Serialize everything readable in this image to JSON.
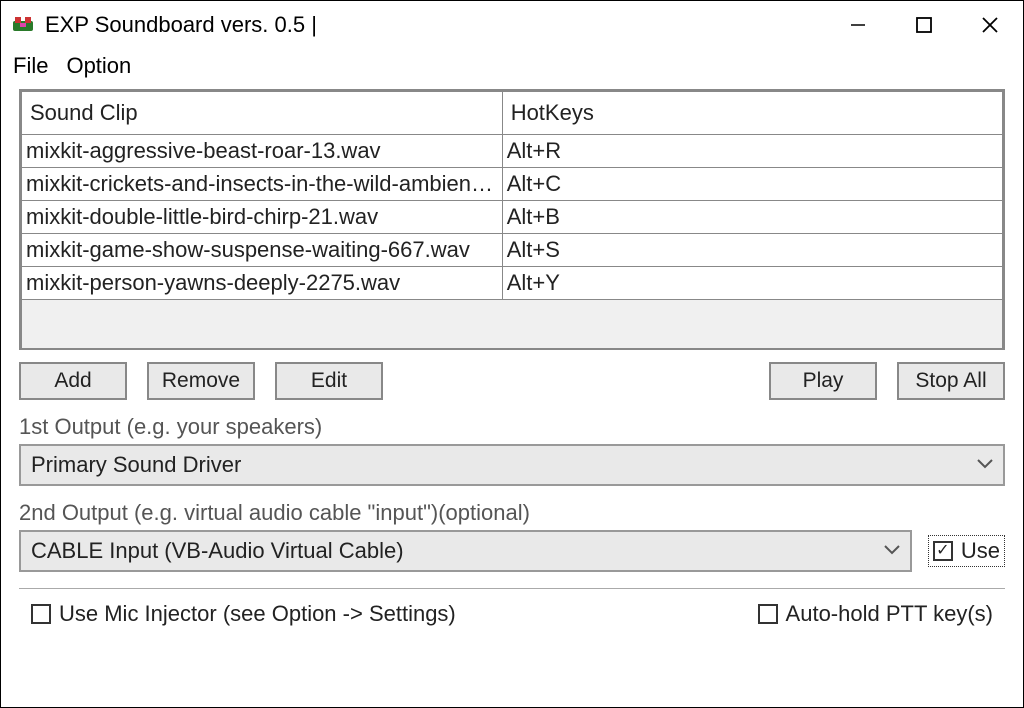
{
  "window": {
    "title": "EXP Soundboard vers. 0.5 |"
  },
  "menu": {
    "file": "File",
    "option": "Option"
  },
  "table": {
    "headers": {
      "clip": "Sound Clip",
      "hotkeys": "HotKeys"
    },
    "rows": [
      {
        "clip": "mixkit-aggressive-beast-roar-13.wav",
        "hotkey": "Alt+R"
      },
      {
        "clip": "mixkit-crickets-and-insects-in-the-wild-ambienc...",
        "hotkey": "Alt+C"
      },
      {
        "clip": "mixkit-double-little-bird-chirp-21.wav",
        "hotkey": "Alt+B"
      },
      {
        "clip": "mixkit-game-show-suspense-waiting-667.wav",
        "hotkey": "Alt+S"
      },
      {
        "clip": "mixkit-person-yawns-deeply-2275.wav",
        "hotkey": "Alt+Y"
      }
    ]
  },
  "buttons": {
    "add": "Add",
    "remove": "Remove",
    "edit": "Edit",
    "play": "Play",
    "stopall": "Stop All"
  },
  "output1": {
    "label": "1st Output (e.g. your speakers)",
    "value": "Primary Sound Driver"
  },
  "output2": {
    "label": "2nd Output (e.g. virtual audio cable \"input\")(optional)",
    "value": "CABLE Input (VB-Audio Virtual Cable)",
    "use_label": "Use",
    "use_checked": true
  },
  "bottom": {
    "mic_injector": "Use Mic Injector (see Option -> Settings)",
    "mic_injector_checked": false,
    "auto_ptt": "Auto-hold PTT key(s)",
    "auto_ptt_checked": false
  }
}
